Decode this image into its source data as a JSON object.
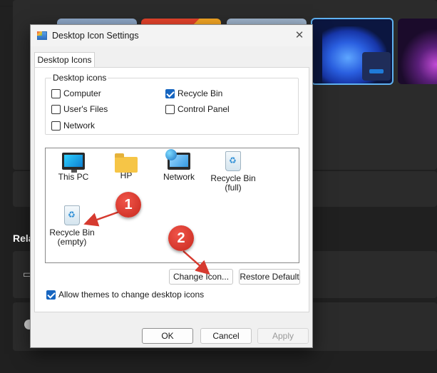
{
  "dialog": {
    "title": "Desktop Icon Settings",
    "close_glyph": "✕",
    "tab": "Desktop Icons",
    "group_title": "Desktop icons",
    "checkboxes": [
      {
        "label": "Computer",
        "checked": false
      },
      {
        "label": "User's Files",
        "checked": false
      },
      {
        "label": "Network",
        "checked": false
      },
      {
        "label": "Recycle Bin",
        "checked": true
      },
      {
        "label": "Control Panel",
        "checked": false
      }
    ],
    "icons": [
      {
        "label": "This PC",
        "icon": "monitor-icon"
      },
      {
        "label": "HP",
        "icon": "folder-icon"
      },
      {
        "label": "Network",
        "icon": "network-icon"
      },
      {
        "label": "Recycle Bin\n(full)",
        "icon": "recycle-bin-full-icon"
      },
      {
        "label": "Recycle Bin\n(empty)",
        "icon": "recycle-bin-empty-icon"
      }
    ],
    "change_icon_label": "Change Icon...",
    "restore_default_label": "Restore Default",
    "allow_themes_label": "Allow themes to change desktop icons",
    "allow_themes_checked": true,
    "ok_label": "OK",
    "cancel_label": "Cancel",
    "apply_label": "Apply"
  },
  "background": {
    "related_heading": "Rela"
  },
  "annotations": {
    "step1": "1",
    "step2": "2",
    "color": "#d63a2f"
  }
}
